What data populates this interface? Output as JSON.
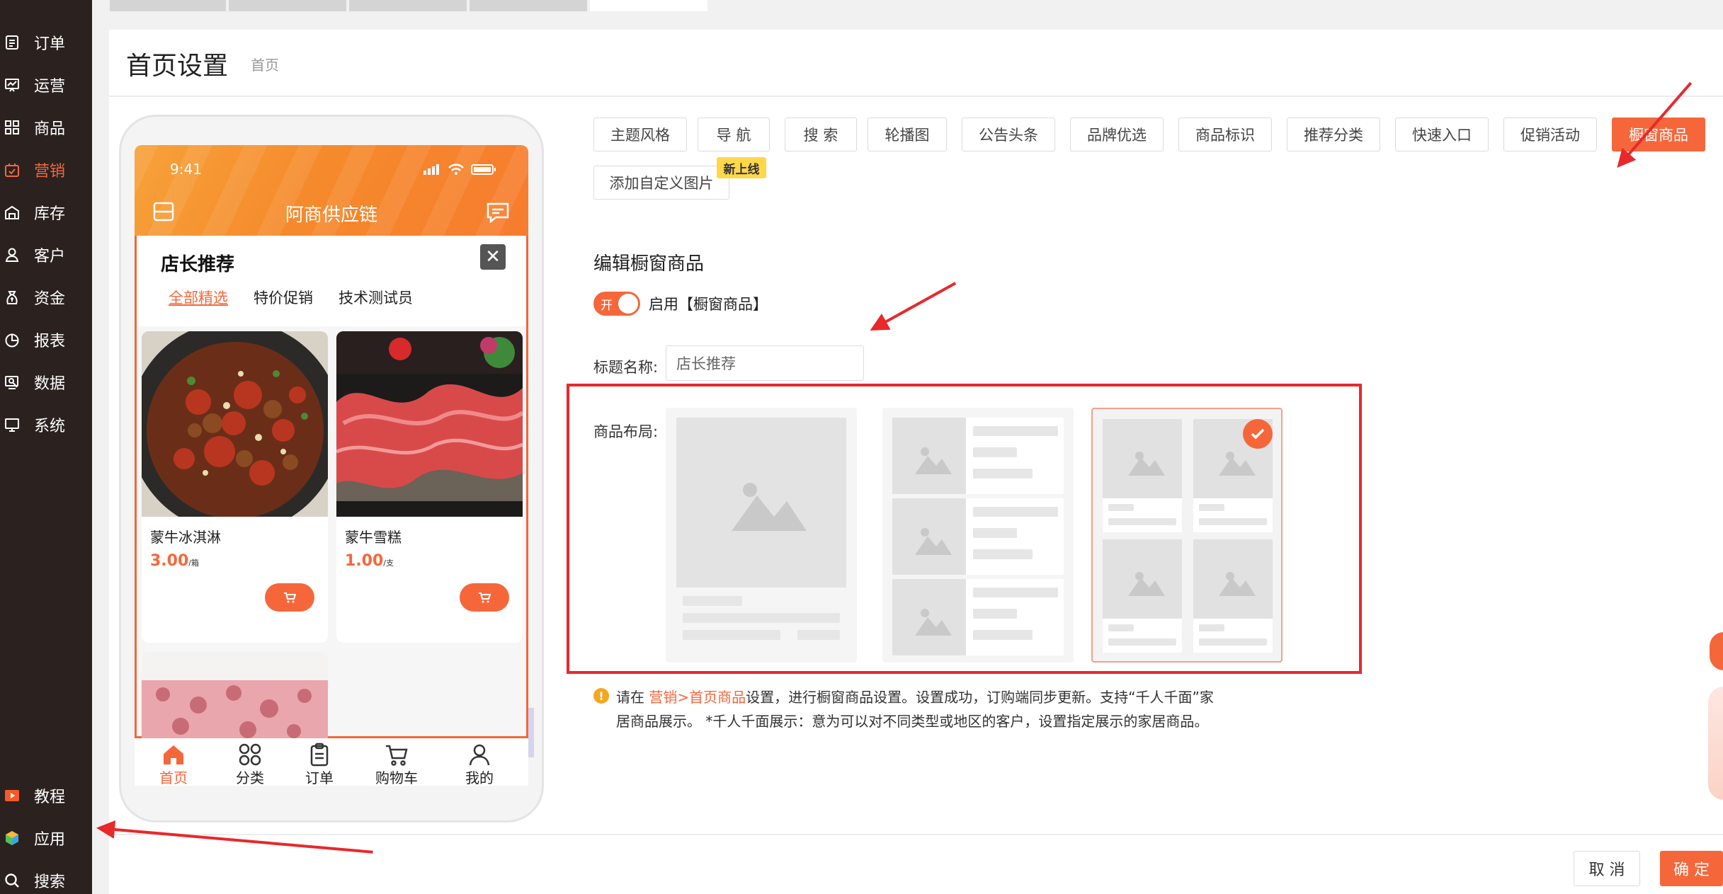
{
  "sidebar": {
    "items": [
      {
        "label": "订单",
        "icon": "orders-icon"
      },
      {
        "label": "运营",
        "icon": "operations-icon"
      },
      {
        "label": "商品",
        "icon": "goods-icon"
      },
      {
        "label": "营销",
        "icon": "marketing-icon",
        "active": true
      },
      {
        "label": "库存",
        "icon": "warehouse-icon"
      },
      {
        "label": "客户",
        "icon": "customer-icon"
      },
      {
        "label": "资金",
        "icon": "money-bag-icon"
      },
      {
        "label": "报表",
        "icon": "pie-chart-icon"
      },
      {
        "label": "数据",
        "icon": "data-icon"
      },
      {
        "label": "系统",
        "icon": "monitor-icon"
      }
    ],
    "bottom": [
      {
        "label": "教程",
        "icon": "video-icon"
      },
      {
        "label": "应用",
        "icon": "cube-icon"
      },
      {
        "label": "搜索",
        "icon": "search-icon"
      }
    ]
  },
  "header": {
    "title": "首页设置",
    "breadcrumb": "首页"
  },
  "phone": {
    "time": "9:41",
    "app_title": "阿商供应链",
    "panel_title": "店长推荐",
    "close_glyph": "✕",
    "tabs": [
      "全部精选",
      "特价促销",
      "技术测试员"
    ],
    "products": [
      {
        "name": "蒙牛冰淇淋",
        "price": "3.00",
        "unit": "/箱"
      },
      {
        "name": "蒙牛雪糕",
        "price": "1.00",
        "unit": "/支"
      }
    ],
    "tabbar": [
      {
        "label": "首页",
        "icon": "home-icon",
        "active": true
      },
      {
        "label": "分类",
        "icon": "category-icon"
      },
      {
        "label": "订单",
        "icon": "order-list-icon"
      },
      {
        "label": "购物车",
        "icon": "cart-icon"
      },
      {
        "label": "我的",
        "icon": "user-icon"
      }
    ]
  },
  "settings": {
    "tabs": [
      "主题风格",
      "导 航",
      "搜 索",
      "轮播图",
      "公告头条",
      "品牌优选",
      "商品标识",
      "推荐分类",
      "快速入口",
      "促销活动",
      "橱窗商品"
    ],
    "active_tab": "橱窗商品",
    "custom_image_label": "添加自定义图片",
    "new_badge": "新上线",
    "section_title": "编辑橱窗商品",
    "toggle_text": "开",
    "toggle_label": "启用【橱窗商品】",
    "title_label": "标题名称:",
    "title_value": "店长推荐",
    "layout_label": "商品布局:",
    "layout_selected": "two-column-grid",
    "hint_prefix": "请在 ",
    "hint_link": "营销>首页商品",
    "hint_text": "设置，进行橱窗商品设置。设置成功，订购端同步更新。支持“千人千面”家居商品展示。 *千人千面展示：意为可以对不同类型或地区的客户，设置指定展示的家居商品。",
    "hint_icon": "!"
  },
  "footer": {
    "cancel": "取 消",
    "confirm": "确 定"
  },
  "colors": {
    "accent": "#f5673b",
    "sidebar_bg": "#2b2220",
    "annotation_red": "#e8282b"
  }
}
